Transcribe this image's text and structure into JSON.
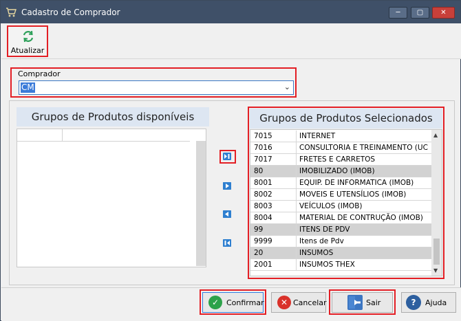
{
  "window": {
    "title": "Cadastro de Comprador",
    "min_glyph": "─",
    "max_glyph": "▢",
    "close_glyph": "✕"
  },
  "toolbar": {
    "atualizar_label": "Atualizar"
  },
  "comprador": {
    "label": "Comprador",
    "value": "CM",
    "chevron": "⌄"
  },
  "available": {
    "header": "Grupos de Produtos disponíveis"
  },
  "selected": {
    "header": "Grupos de Produtos Selecionados",
    "rows": [
      {
        "code": "7015",
        "name": "INTERNET",
        "group": false
      },
      {
        "code": "7016",
        "name": "CONSULTORIA E TREINAMENTO (UC",
        "group": false
      },
      {
        "code": "7017",
        "name": "FRETES E CARRETOS",
        "group": false
      },
      {
        "code": "80",
        "name": "IMOBILIZADO (IMOB)",
        "group": true
      },
      {
        "code": "8001",
        "name": "EQUIP. DE INFORMATICA (IMOB)",
        "group": false
      },
      {
        "code": "8002",
        "name": "MOVEIS E UTENSÍLIOS (IMOB)",
        "group": false
      },
      {
        "code": "8003",
        "name": "VEÍCULOS (IMOB)",
        "group": false
      },
      {
        "code": "8004",
        "name": "MATERIAL DE CONTRUÇÃO (IMOB)",
        "group": false
      },
      {
        "code": "99",
        "name": "ITENS DE PDV",
        "group": true
      },
      {
        "code": "9999",
        "name": "Itens de Pdv",
        "group": false
      },
      {
        "code": "20",
        "name": "INSUMOS",
        "group": true
      },
      {
        "code": "2001",
        "name": "INSUMOS THEX",
        "group": false
      }
    ]
  },
  "buttons": {
    "confirmar": "Confirmar",
    "cancelar": "Cancelar",
    "sair": "Sair",
    "ajuda": "Ajuda",
    "cancel_glyph": "✕",
    "help_glyph": "?",
    "confirm_glyph": "✓"
  },
  "colors": {
    "highlight": "#e31e24",
    "titlebar": "#3f5068",
    "accent_blue": "#2e7fd0"
  }
}
